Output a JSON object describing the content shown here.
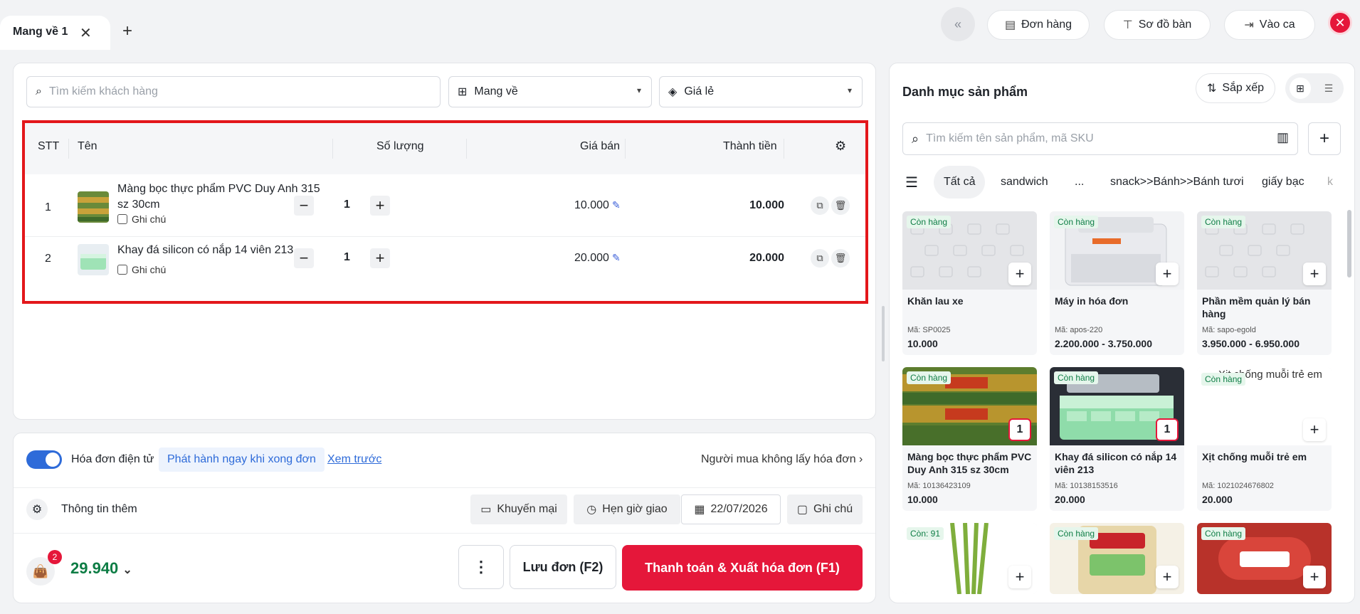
{
  "tabs": {
    "active_label": "Mang về 1"
  },
  "header": {
    "orders_label": "Đơn hàng",
    "table_map_label": "Sơ đồ bàn",
    "shift_label": "Vào ca"
  },
  "customer": {
    "search_placeholder": "Tìm kiếm khách hàng",
    "order_type": "Mang về",
    "price_list": "Giá lẻ"
  },
  "cart": {
    "columns": [
      "STT",
      "Tên",
      "Số lượng",
      "Giá bán",
      "Thành tiền"
    ],
    "note_label": "Ghi chú",
    "items": [
      {
        "stt": "1",
        "name": "Màng bọc thực phẩm PVC Duy Anh 315 sz 30cm",
        "qty": "1",
        "price": "10.000",
        "total": "10.000"
      },
      {
        "stt": "2",
        "name": "Khay đá silicon có nắp 14 viên 213",
        "qty": "1",
        "price": "20.000",
        "total": "20.000"
      }
    ]
  },
  "invoice": {
    "toggle_label": "Hóa đơn điện tử",
    "issue_option": "Phát hành ngay khi xong đơn",
    "preview_link": "Xem trước",
    "buyer_no_invoice": "Người mua không lấy hóa đơn"
  },
  "extra": {
    "label": "Thông tin thêm",
    "promo": "Khuyến mại",
    "schedule": "Hẹn giờ giao",
    "date": "22/07/2026",
    "note": "Ghi chú"
  },
  "checkout": {
    "item_count": "2",
    "amount": "29.940",
    "save_label": "Lưu đơn (F2)",
    "pay_label": "Thanh toán & Xuất hóa đơn (F1)"
  },
  "catalog": {
    "title": "Danh mục sản phẩm",
    "sort_label": "Sắp xếp",
    "search_placeholder": "Tìm kiếm tên sản phẩm, mã SKU",
    "categories": [
      "Tất cả",
      "sandwich",
      "...",
      "snack>>Bánh>>Bánh tươi",
      "giấy bạc",
      "k"
    ],
    "products": [
      {
        "stock": "Còn hàng",
        "name": "Khăn lau xe",
        "sku": "Mã: SP0025",
        "price": "10.000"
      },
      {
        "stock": "Còn hàng",
        "name": "Máy in hóa đơn",
        "sku": "Mã: apos-220",
        "price": "2.200.000 - 3.750.000"
      },
      {
        "stock": "Còn hàng",
        "name": "Phần mềm quản lý bán hàng",
        "sku": "Mã: sapo-egold",
        "price": "3.950.000 - 6.950.000"
      },
      {
        "stock": "Còn hàng",
        "name": "Màng bọc thực phẩm PVC Duy Anh 315 sz 30cm",
        "sku": "Mã: 10136423109",
        "price": "10.000",
        "qty": "1"
      },
      {
        "stock": "Còn hàng",
        "name": "Khay đá silicon có nắp 14 viên 213",
        "sku": "Mã: 10138153516",
        "price": "20.000",
        "qty": "1"
      },
      {
        "stock": "Còn hàng",
        "name": "Xịt chống muỗi trẻ em",
        "sku": "Mã: 1021024676802",
        "price": "20.000",
        "alt": "Xịt chống muỗi trẻ em"
      },
      {
        "stock": "Còn: 91"
      },
      {
        "stock": "Còn hàng"
      },
      {
        "stock": "Còn hàng"
      }
    ]
  },
  "colors": {
    "primary_red": "#e5173a",
    "accent_blue": "#2e6bd9",
    "amount_green": "#0e7d45"
  }
}
